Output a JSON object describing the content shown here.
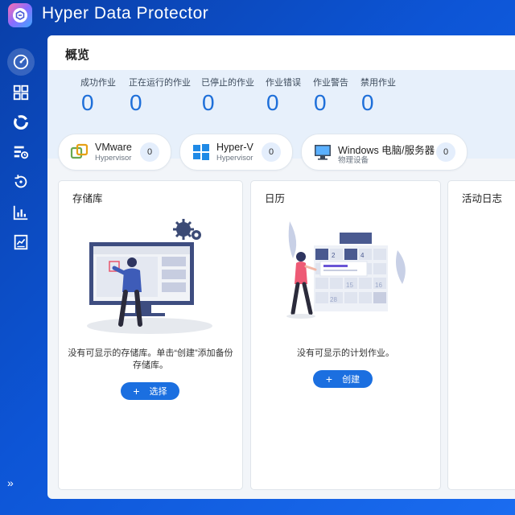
{
  "app": {
    "title": "Hyper Data Protector",
    "logo_icon": "app-logo-icon"
  },
  "sidebar": {
    "items": [
      {
        "icon": "dashboard-gauge-icon",
        "active": true
      },
      {
        "icon": "grid-apps-icon",
        "active": false
      },
      {
        "icon": "pie-storage-icon",
        "active": false
      },
      {
        "icon": "backup-jobs-icon",
        "active": false
      },
      {
        "icon": "restore-icon",
        "active": false
      },
      {
        "icon": "bar-chart-icon",
        "active": false
      },
      {
        "icon": "report-icon",
        "active": false
      }
    ],
    "expand_icon": "double-chevron-right-icon",
    "expand_glyph": "»"
  },
  "overview": {
    "title": "概览",
    "stats": [
      {
        "label": "成功作业",
        "value": "0"
      },
      {
        "label": "正在运行的作业",
        "value": "0"
      },
      {
        "label": "已停止的作业",
        "value": "0"
      },
      {
        "label": "作业错误",
        "value": "0"
      },
      {
        "label": "作业警告",
        "value": "0"
      },
      {
        "label": "禁用作业",
        "value": "0"
      }
    ]
  },
  "hypervisors": [
    {
      "name": "VMware",
      "sub": "Hypervisor",
      "count": "0",
      "icon": "vmware-icon"
    },
    {
      "name": "Hyper-V",
      "sub": "Hypervisor",
      "count": "0",
      "icon": "windows-icon"
    },
    {
      "name": "Windows 电脑/服务器",
      "sub": "物理设备",
      "count": "0",
      "icon": "monitor-icon"
    }
  ],
  "cards": {
    "repository": {
      "title": "存储库",
      "empty_line1": "没有可显示的存储库。单击“创建”添加备份",
      "empty_line2": "存储库。",
      "button": "选择"
    },
    "calendar": {
      "title": "日历",
      "empty": "没有可显示的计划作业。",
      "button": "创建",
      "dates": [
        "2",
        "4",
        "15",
        "16",
        "28"
      ]
    },
    "activity": {
      "title": "活动日志"
    }
  },
  "colors": {
    "accent": "#1b6fe0",
    "value_blue": "#1e6fd9",
    "stats_bg": "#e7f0fb"
  }
}
